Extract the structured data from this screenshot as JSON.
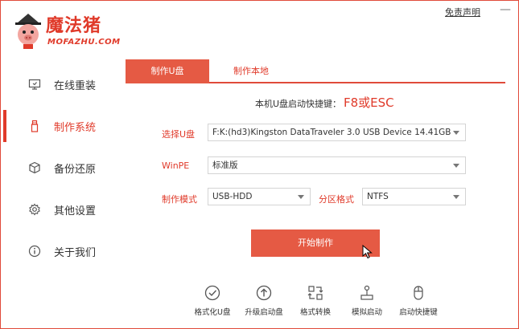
{
  "header": {
    "logo_title": "魔法猪",
    "logo_subtitle": "MOFAZHU.COM",
    "disclaimer": "免责声明",
    "minimize": "—"
  },
  "sidebar": {
    "items": [
      {
        "label": "在线重装",
        "icon": "monitor-icon"
      },
      {
        "label": "制作系统",
        "icon": "usb-icon"
      },
      {
        "label": "备份还原",
        "icon": "cube-icon"
      },
      {
        "label": "其他设置",
        "icon": "gear-icon"
      },
      {
        "label": "关于我们",
        "icon": "info-icon"
      }
    ],
    "active_index": 1
  },
  "tabs": [
    {
      "label": "制作U盘"
    },
    {
      "label": "制作本地"
    }
  ],
  "hint": {
    "text": "本机U盘启动快捷键：",
    "key": "F8或ESC"
  },
  "form": {
    "usb_label": "选择U盘",
    "usb_value": "F:K:(hd3)Kingston DataTraveler 3.0 USB Device 14.41GB",
    "winpe_label": "WinPE",
    "winpe_value": "标准版",
    "mode_label": "制作模式",
    "mode_value": "USB-HDD",
    "partition_label": "分区格式",
    "partition_value": "NTFS"
  },
  "start_button": "开始制作",
  "tools": [
    {
      "label": "格式化U盘",
      "icon": "check-circle-icon"
    },
    {
      "label": "升级启动盘",
      "icon": "arrow-up-circle-icon"
    },
    {
      "label": "格式转换",
      "icon": "convert-icon"
    },
    {
      "label": "模拟启动",
      "icon": "joystick-icon"
    },
    {
      "label": "启动快捷键",
      "icon": "mouse-icon"
    }
  ],
  "colors": {
    "accent": "#e03a2a",
    "button": "#e55a44"
  }
}
